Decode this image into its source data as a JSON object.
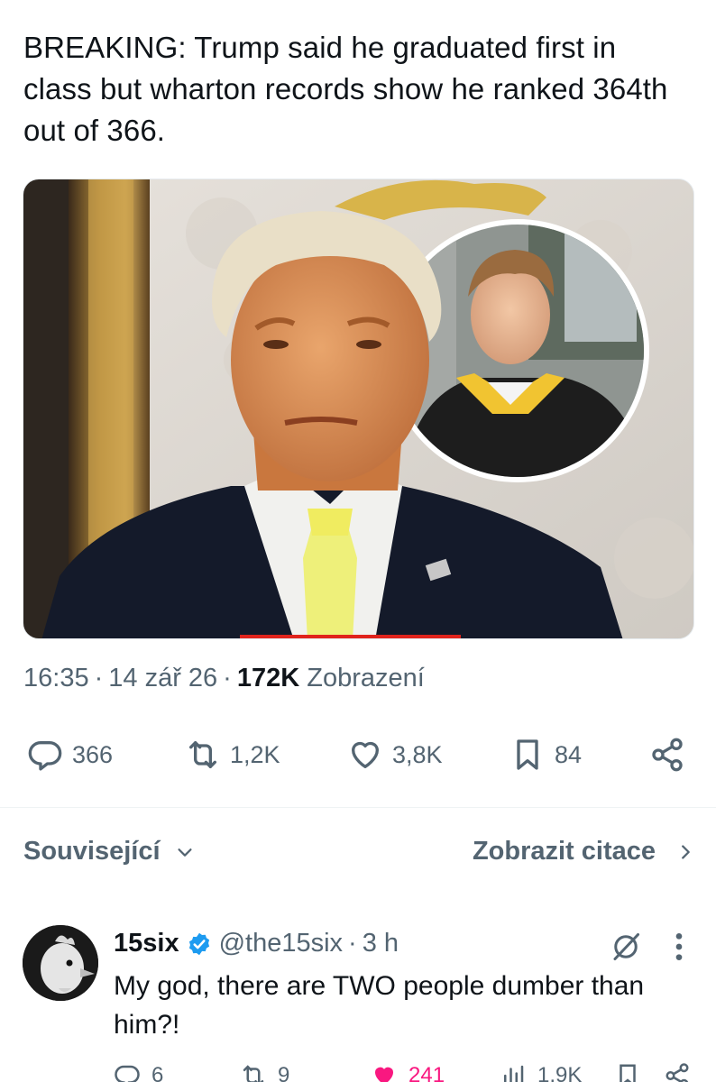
{
  "tweet": {
    "text": "BREAKING: Trump said he graduated first in class but wharton records show he ranked 364th out of 366.",
    "time": "16:35",
    "date": "14 zář 26",
    "views_count": "172K",
    "views_label": "Zobrazení",
    "separator": "·"
  },
  "actions": {
    "replies": "366",
    "retweets": "1,2K",
    "likes": "3,8K",
    "bookmarks": "84"
  },
  "related": {
    "label": "Související",
    "quotes_label": "Zobrazit citace"
  },
  "reply": {
    "name": "15six",
    "handle": "@the15six",
    "separator": "·",
    "time": "3 h",
    "text": "My god, there are TWO people dumber than him?!",
    "actions": {
      "replies": "6",
      "retweets": "9",
      "likes": "241",
      "views": "1,9K"
    }
  },
  "colors": {
    "text_primary": "#0f1419",
    "text_secondary": "#536471",
    "verified_blue": "#1d9bf0",
    "like_pink": "#f91880"
  },
  "icons": {
    "reply": "reply-icon",
    "retweet": "retweet-icon",
    "like": "heart-icon",
    "bookmark": "bookmark-icon",
    "share": "share-icon",
    "views": "views-icon",
    "grok": "grok-icon",
    "more": "more-icon",
    "verified": "verified-badge-icon",
    "chevron_down": "chevron-down-icon",
    "chevron_right": "chevron-right-icon"
  }
}
